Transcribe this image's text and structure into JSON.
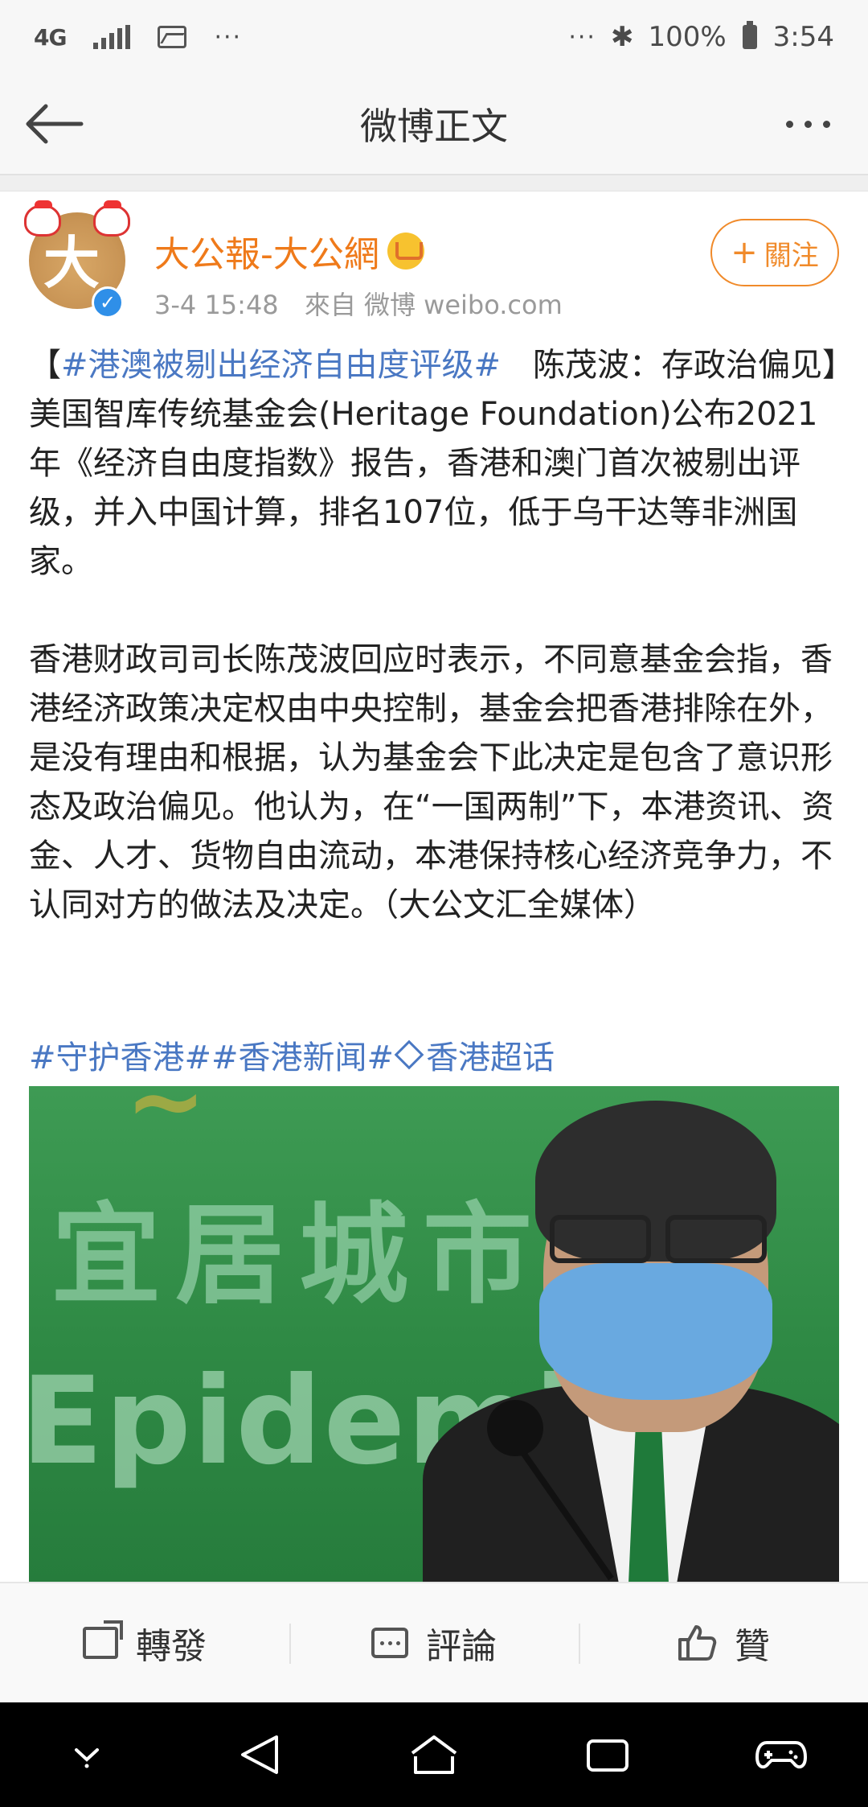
{
  "status_bar": {
    "network": "4G",
    "overflow": "···",
    "right_overflow": "···",
    "battery": "100%",
    "time": "3:54"
  },
  "nav": {
    "title": "微博正文"
  },
  "post": {
    "author": "大公報-大公網",
    "timestamp": "3-4 15:48",
    "source": "來自 微博 weibo.com",
    "follow_label": "關注",
    "follow_plus": "+",
    "paragraph1": {
      "bracket_open": "【",
      "topic": "#港澳被剔出经济自由度评级#",
      "text": "　陈茂波：存政治偏见】美国智库传统基金会(Heritage Foundation)公布2021年《经济自由度指数》报告，香港和澳门首次被剔出评级，并入中国计算，排名107位，低于乌干达等非洲国家。"
    },
    "paragraph2": "香港财政司司长陈茂波回应时表示，不同意基金会指，香港经济政策决定权由中央控制，基金会把香港排除在外，是没有理由和根据，认为基金会下此决定是包含了意识形态及政治偏见。他认为，在“一国两制”下，本港资讯、资金、人才、货物自由流动，本港保持核心经济竞争力，不认同对方的做法及决定。（大公文汇全媒体）",
    "topics_line": {
      "part1": "#守护香港##香港新闻#",
      "part2": "香港超话"
    },
    "photo": {
      "bg_text_cn": "宜居城市",
      "bg_text_en": "Epidemic"
    }
  },
  "actions": {
    "repost": "轉發",
    "comment": "評論",
    "like": "贊"
  },
  "colors": {
    "accent_orange": "#ef7a1a",
    "topic_blue": "#4a78c3",
    "verified_blue": "#2f8fe8"
  },
  "icons": [
    "back-arrow-icon",
    "more-icon",
    "verified-icon",
    "vip-crown-icon",
    "repost-icon",
    "comment-icon",
    "like-icon",
    "diamond-icon"
  ]
}
